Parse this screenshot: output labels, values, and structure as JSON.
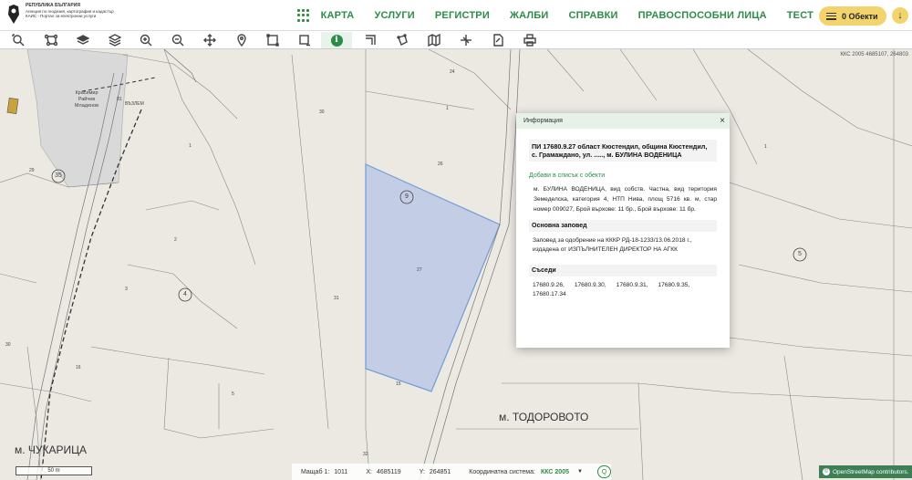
{
  "header": {
    "logo_line1": "РЕПУБЛИКА БЪЛГАРИЯ",
    "logo_line2": "Агенция по геодезия, картография и кадастър",
    "logo_line3": "КАИС - Портал за електронни услуги",
    "nav": [
      "КАРТА",
      "УСЛУГИ",
      "РЕГИСТРИ",
      "ЖАЛБИ",
      "СПРАВКИ",
      "ПРАВОСПОСОБНИ ЛИЦА",
      "ТЕСТ"
    ],
    "objects_label": "0 Обекти"
  },
  "toolbar": {
    "tools": [
      "zoom-to-extent-icon",
      "network-icon",
      "layers-icon",
      "layers-stack-icon",
      "zoom-in-icon",
      "zoom-out-icon",
      "pan-icon",
      "location-pin-icon",
      "select-rectangle-icon",
      "select-rectangle-minus-icon",
      "info-icon",
      "measure-corner-icon",
      "measure-area-icon",
      "map-icon",
      "crosshair-icon",
      "document-edit-icon",
      "print-icon"
    ],
    "info_symbol": "i"
  },
  "map": {
    "coord_label": "ККС 2005 4685107, 264803",
    "big_labels": [
      "м. ТОДОРОВОТО",
      "м. ЧУКАРИЦА"
    ],
    "owner_label": [
      "Красимир",
      "Райчев",
      "Младенов"
    ],
    "road_label": "ВЪЗЛЕМ",
    "parcel_numbers": [
      "81",
      "30",
      "24",
      "26",
      "27",
      "29",
      "31",
      "1",
      "1",
      "2",
      "3",
      "16",
      "30",
      "5",
      "15",
      "32",
      "1"
    ],
    "circle_labels": [
      "35",
      "4",
      "9",
      "5"
    ]
  },
  "popup": {
    "title": "Информация",
    "close": "×",
    "parcel_title": "ПИ 17680.9.27 област Кюстендил, община Кюстендил, с. Грамаждано, ул. ....., м. БУЛИНА ВОДЕНИЦА",
    "add_link": "Добави в списък с обекти",
    "description": "м. БУЛИНА ВОДЕНИЦА, вид собств. Частна, вид територия Земеделска, категория 4, НТП Нива, площ 5716 кв. м, стар номер 009027, Брой върхове: 11 бр., Брой върхове: 11 бр.",
    "order_heading": "Основна заповед",
    "order_text": "Заповед за одобрение на КККР РД-18-1233/13.06.2018 г., издадена от ИЗПЪЛНИТЕЛЕН ДИРЕКТОР НА АГКК",
    "neighbors_heading": "Съседи",
    "neighbors": "17680.9.26,      17680.9.30,      17680.9.31,      17680.9.35, 17680.17.34"
  },
  "statusbar": {
    "scale_label": "50 m",
    "scale_prefix": "Мащаб 1:",
    "scale_value": "1011",
    "x_label": "X:",
    "x_value": "4685119",
    "y_label": "Y:",
    "y_value": "264851",
    "crs_label": "Координатна система:",
    "crs_value": "ККС 2005",
    "caret": "▼",
    "search_symbol": "Q",
    "osm_symbol": "©",
    "osm_text": "OpenStreetMap contributors."
  }
}
